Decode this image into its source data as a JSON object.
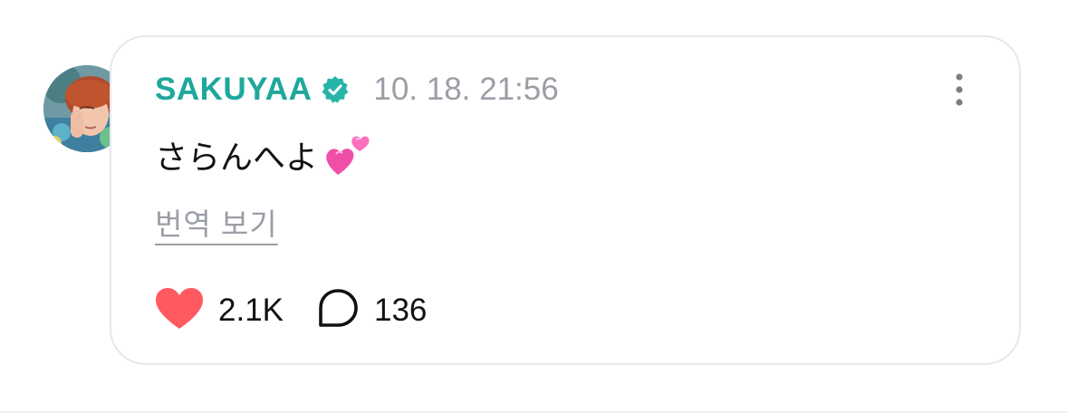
{
  "post": {
    "author": "SAKUYAA",
    "timestamp": "10. 18. 21:56",
    "text": "さらんへよ",
    "translate_label": "번역 보기",
    "likes": "2.1K",
    "comments": "136"
  },
  "icons": {
    "verified": "verified-badge-icon",
    "more": "more-options-icon",
    "hearts_emoji": "two-hearts-emoji",
    "like": "heart-icon",
    "comment": "comment-bubble-icon"
  },
  "colors": {
    "author": "#1ea89b",
    "verified_badge": "#29b4a8",
    "timestamp": "#9b9ea6",
    "like_heart": "#ff5a5f",
    "card_border": "#e6e7ec"
  }
}
